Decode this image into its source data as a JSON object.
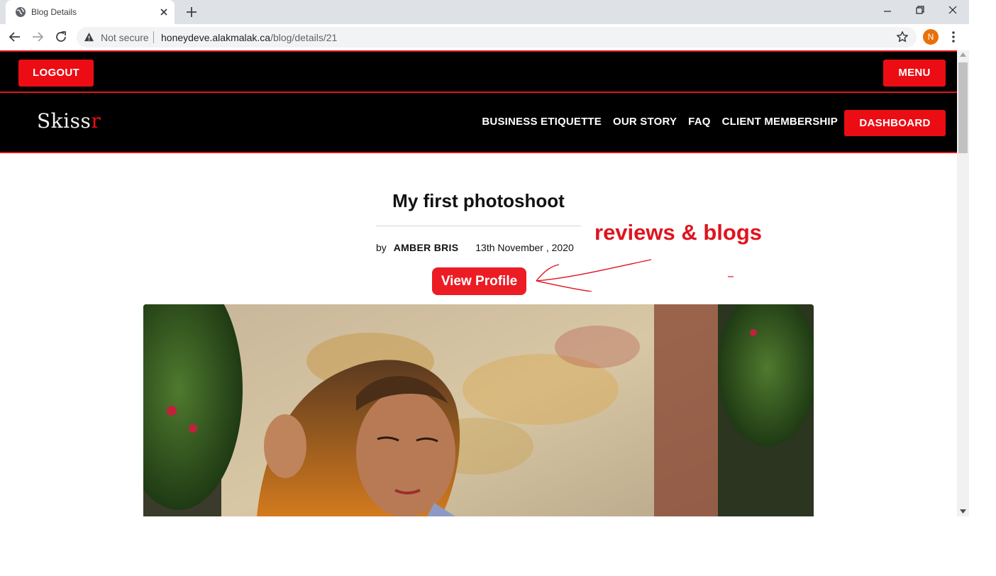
{
  "browser": {
    "tab_title": "Blog Details",
    "security_label": "Not secure",
    "url_host": "honeydeve.alakmalak.ca",
    "url_path": "/blog/details/21",
    "profile_initial": "N"
  },
  "header": {
    "logout_label": "LOGOUT",
    "menu_label": "MENU",
    "logo_main": "Skiss",
    "logo_accent": "r",
    "nav_items": [
      "BUSINESS ETIQUETTE",
      "OUR STORY",
      "FAQ",
      "CLIENT MEMBERSHIP"
    ],
    "dashboard_label": "DASHBOARD"
  },
  "post": {
    "title": "My first photoshoot",
    "by_label": "by",
    "author": "AMBER BRIS",
    "date": "13th November , 2020",
    "view_profile_label": "View Profile"
  },
  "annotation": {
    "text": "reviews & blogs",
    "color": "#e0131e"
  },
  "colors": {
    "accent": "#ec0c14",
    "header_bg": "#000000"
  }
}
